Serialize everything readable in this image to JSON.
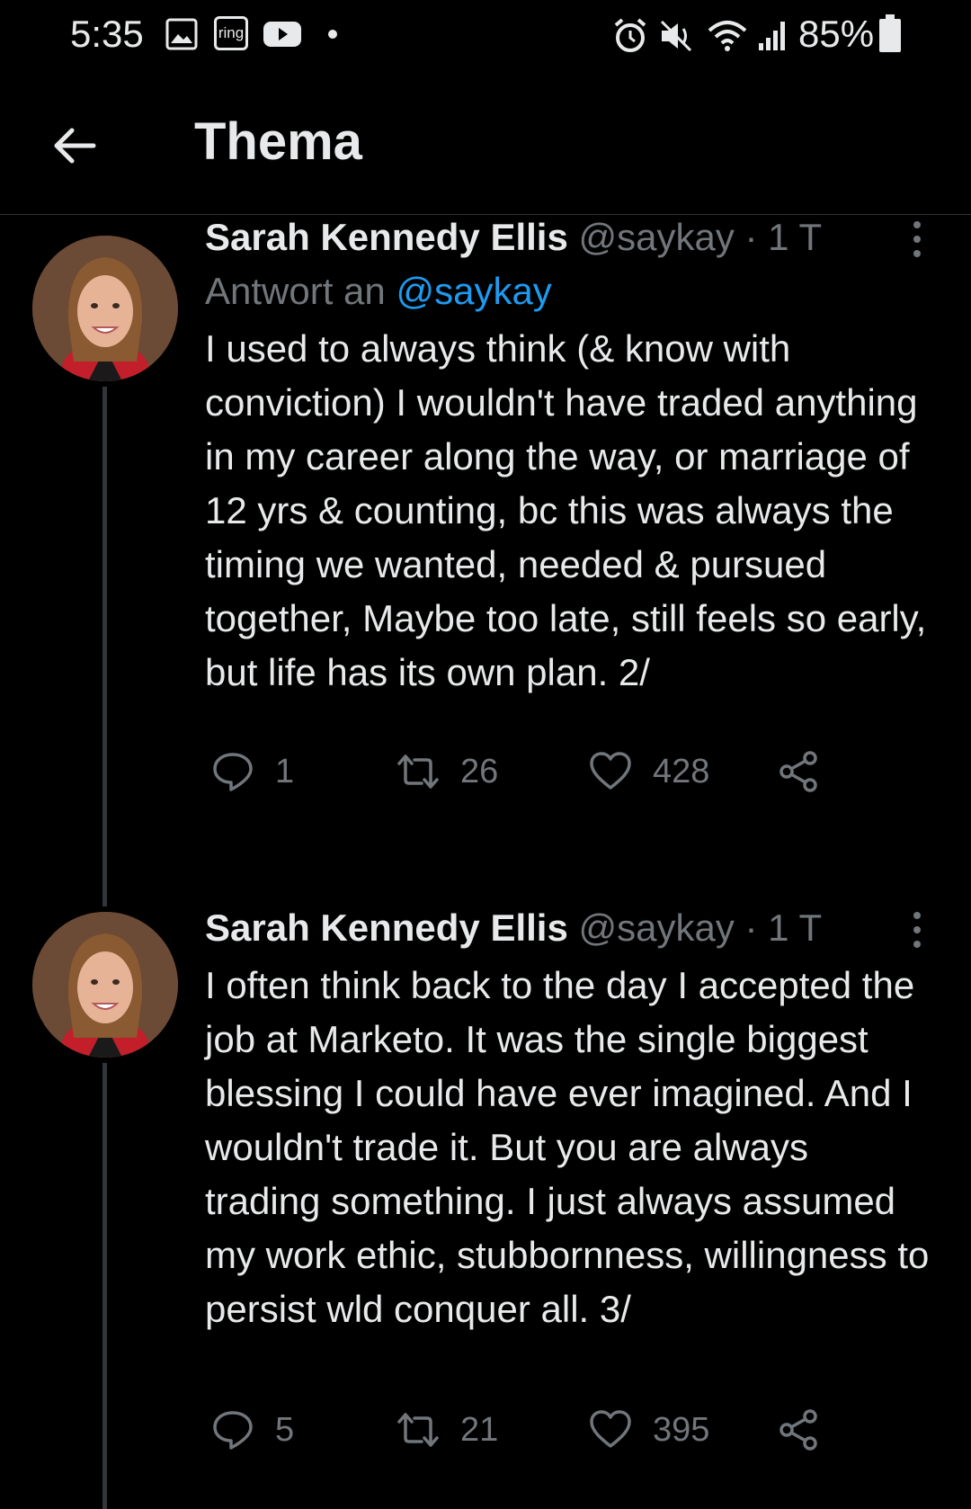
{
  "status_bar": {
    "time": "5:35",
    "notification_icons": [
      "image-icon",
      "ring-icon",
      "youtube-icon",
      "dot-icon"
    ],
    "ring_label": "ring",
    "system_icons": [
      "alarm-icon",
      "mute-icon",
      "wifi-icon",
      "signal-icon",
      "battery-icon"
    ],
    "battery": "85%"
  },
  "header": {
    "title": "Thema"
  },
  "colors": {
    "background": "#000000",
    "text": "#e7e9ea",
    "muted": "#71767b",
    "link": "#1d9bf0",
    "line": "#333639"
  },
  "tweets": [
    {
      "name": "Sarah Kennedy Ellis",
      "handle": "@saykay",
      "time": "· 1 T",
      "reply_prefix": "Antwort an",
      "reply_handle": "@saykay",
      "text": "I used to always think (& know with conviction) I wouldn't have traded anything in my career along the way, or marriage of 12 yrs & counting, bc this was always the timing we wanted, needed & pursued together, Maybe too late, still feels so early, but life has its own plan. 2/",
      "replies": "1",
      "retweets": "26",
      "likes": "428"
    },
    {
      "name": "Sarah Kennedy Ellis",
      "handle": "@saykay",
      "time": "· 1 T",
      "text": "I often think back to the day I accepted the job at Marketo. It was the single biggest blessing I could have ever imagined. And I wouldn't trade it. But you are always trading something. I just always assumed my work ethic, stubbornness, willingness to persist wld conquer all. 3/",
      "replies": "5",
      "retweets": "21",
      "likes": "395"
    }
  ]
}
